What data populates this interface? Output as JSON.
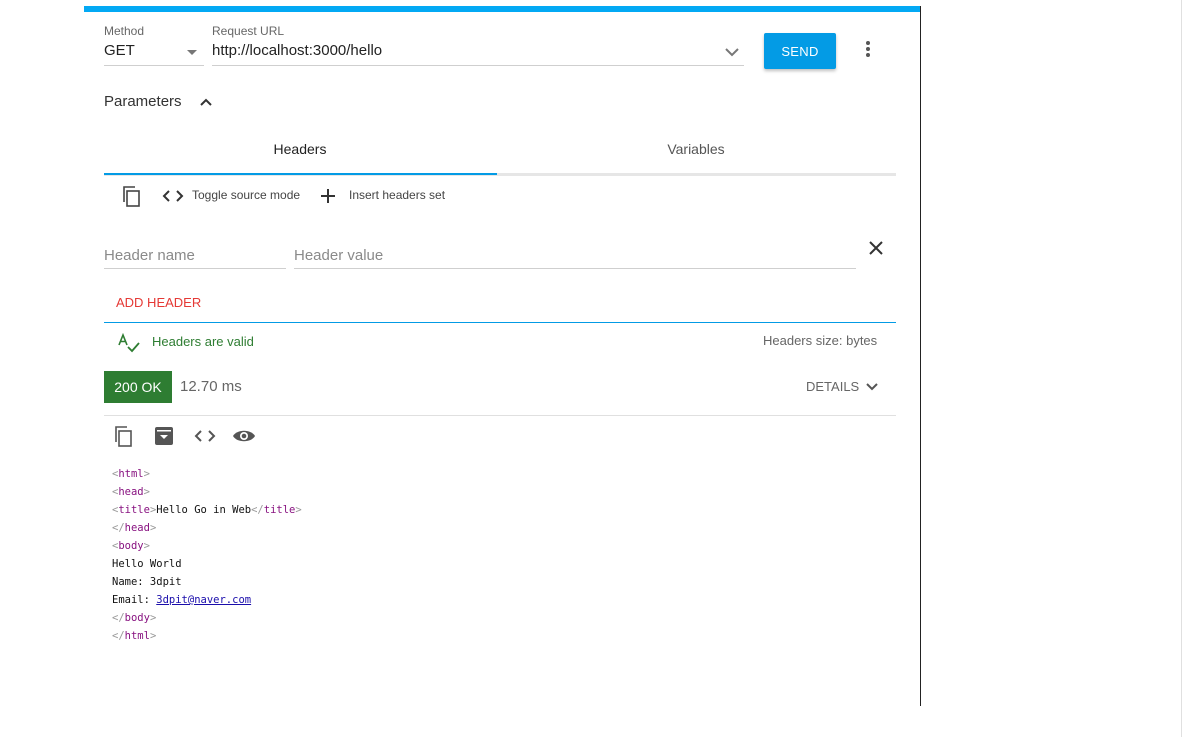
{
  "request": {
    "method_label": "Method",
    "method_value": "GET",
    "url_label": "Request URL",
    "url_value": "http://localhost:3000/hello",
    "send_label": "SEND"
  },
  "parameters": {
    "title": "Parameters",
    "tabs": [
      {
        "label": "Headers",
        "active": true
      },
      {
        "label": "Variables",
        "active": false
      }
    ],
    "toolbar": {
      "toggle_label": "Toggle source mode",
      "insert_label": "Insert headers set"
    },
    "header_name_placeholder": "Header name",
    "header_value_placeholder": "Header value",
    "add_header_label": "ADD HEADER",
    "valid_text": "Headers are valid",
    "size_text": "Headers size: bytes"
  },
  "response": {
    "status": "200 OK",
    "time": "12.70 ms",
    "details_label": "DETAILS",
    "body": {
      "title_text": "Hello Go in Web",
      "line_hello": "Hello World",
      "line_name": "Name: 3dpit",
      "email_prefix": "Email: ",
      "email_link": "3dpit@naver.com"
    }
  },
  "colors": {
    "accent": "#03a9f4",
    "status_ok": "#2e7d32",
    "add_header": "#e53935"
  },
  "icons": [
    "copy-icon",
    "code-icon",
    "plus-icon",
    "close-icon",
    "spellcheck-icon",
    "chevron-up-icon",
    "chevron-down-icon",
    "more-vert-icon",
    "archive-icon",
    "eye-icon"
  ]
}
